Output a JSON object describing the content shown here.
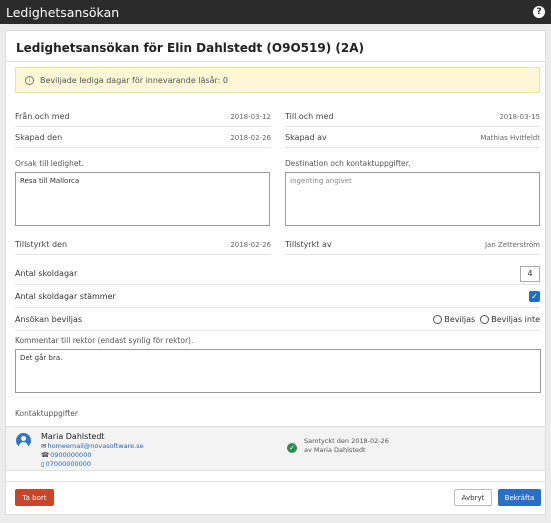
{
  "window": {
    "title": "Ledighetsansökan"
  },
  "heading": "Ledighetsansökan för Elin Dahlstedt (O9O519) (2A)",
  "alert": {
    "text": "Beviljade lediga dagar för innevarande läsår: ",
    "count": "0"
  },
  "rows": {
    "from_label": "Från och med",
    "from_value": "2018-03-12",
    "to_label": "Till och med",
    "to_value": "2018-03-15",
    "created_label": "Skapad den",
    "created_value": "2018-02-26",
    "created_by_label": "Skapad av",
    "created_by_value": "Mathias Hvitfeldt",
    "endorsed_label": "Tillstyrkt den",
    "endorsed_value": "2018-02-26",
    "endorsed_by_label": "Tillstyrkt av",
    "endorsed_by_value": "Jan Zetterström"
  },
  "reason": {
    "label": "Orsak till ledighet.",
    "value": "Resa till Mallorca"
  },
  "destination": {
    "label": "Destination och kontaktuppgifter.",
    "placeholder": "Ingenting angivet"
  },
  "school_days": {
    "label": "Antal skoldagar",
    "value": "4"
  },
  "days_match": {
    "label": "Antal skoldagar stämmer",
    "checked_glyph": "✓"
  },
  "approval": {
    "label": "Ansökan beviljas",
    "options": [
      "Beviljas",
      "Beviljas inte"
    ]
  },
  "comment": {
    "label": "Kommentar till rektor (endast synlig för rektor).",
    "value": "Det går bra."
  },
  "contacts": {
    "label": "Kontaktuppgifter",
    "name": "Maria Dahlstedt",
    "email": "homeemail@novasoftware.se",
    "phone1": "0900000000",
    "phone2": "07000000000",
    "consent_line1": "Samtyckt den 2018-02-26",
    "consent_line2": "av Maria Dahlstedt"
  },
  "buttons": {
    "delete": "Ta bort",
    "cancel": "Avbryt",
    "confirm": "Bekräfta"
  },
  "colors": {
    "primary": "#2a6fc1",
    "danger": "#c8452a",
    "success": "#2e8b57",
    "alert_bg": "#fdf7d6"
  },
  "icons": {
    "help": "help-icon",
    "info": "info-icon",
    "email": "email-icon",
    "phone": "phone-icon",
    "mobile": "mobile-icon",
    "check": "check-circle-icon",
    "avatar": "user-avatar-icon"
  }
}
